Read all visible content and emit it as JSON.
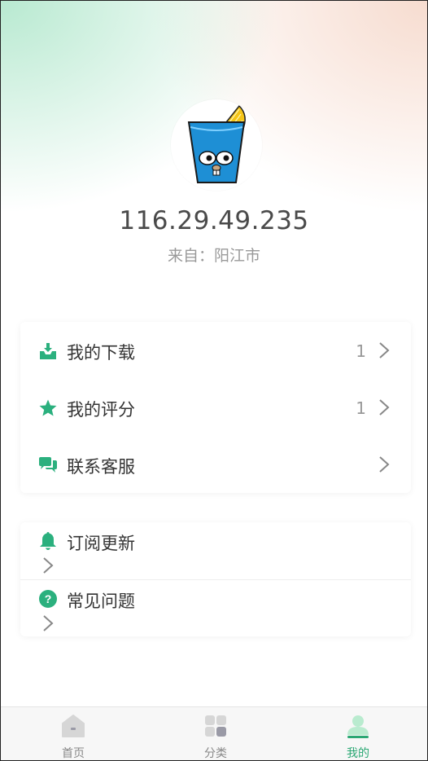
{
  "profile": {
    "ip": "116.29.49.235",
    "location": "来自：阳江市"
  },
  "menu_primary": [
    {
      "label": "我的下载",
      "count": "1",
      "icon": "download-tray-icon"
    },
    {
      "label": "我的评分",
      "count": "1",
      "icon": "star-icon"
    },
    {
      "label": "联系客服",
      "count": "",
      "icon": "chat-bubbles-icon"
    }
  ],
  "menu_secondary": [
    {
      "label": "订阅更新",
      "icon": "bell-icon"
    },
    {
      "label": "常见问题",
      "icon": "question-circle-icon"
    }
  ],
  "tabbar": [
    {
      "label": "首页",
      "icon": "home-icon",
      "active": false
    },
    {
      "label": "分类",
      "icon": "category-grid-icon",
      "active": false
    },
    {
      "label": "我的",
      "icon": "user-icon",
      "active": true
    }
  ],
  "colors": {
    "accent": "#2aa773",
    "icon_green": "#2bb07e",
    "inactive": "#888888"
  }
}
